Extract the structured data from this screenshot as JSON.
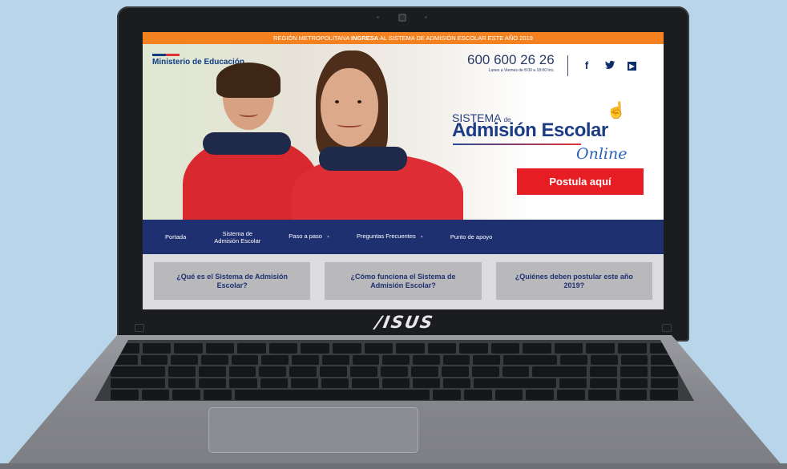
{
  "device": {
    "brand": "/ISUS"
  },
  "site": {
    "announcement_pre": "REGIÓN METROPOLITANA ",
    "announcement_bold": "INGRESA",
    "announcement_post": " AL SISTEMA DE ADMISIÓN ESCOLAR ESTE AÑO 2019",
    "ministry": "Ministerio de Educación",
    "phone": "600 600 26 26",
    "phone_hours": "Lunes a Viernes de 8:00 a 18:00 hrs.",
    "social": {
      "facebook": "f",
      "twitter": "🐦",
      "youtube": "▶"
    },
    "logo": {
      "sistema": "SISTEMA",
      "de": "de",
      "admision": "Admisión Escolar",
      "online": "Online"
    },
    "cta_label": "Postula aquí",
    "nav": [
      {
        "label": "Portada"
      },
      {
        "label": "Sistema de Admisión Escolar"
      },
      {
        "label": "Paso a paso"
      },
      {
        "label": "Preguntas Frecuentes"
      },
      {
        "label": "Punto de apoyo"
      }
    ],
    "cards": [
      {
        "label": "¿Qué es el Sistema de Admisión Escolar?"
      },
      {
        "label": "¿Cómo funciona el Sistema de Admisión Escolar?"
      },
      {
        "label": "¿Quiénes deben postular este año 2019?"
      }
    ]
  },
  "colors": {
    "announcement": "#f48120",
    "nav": "#1f3070",
    "cta": "#e61e23",
    "brand_blue": "#1c3c84"
  }
}
